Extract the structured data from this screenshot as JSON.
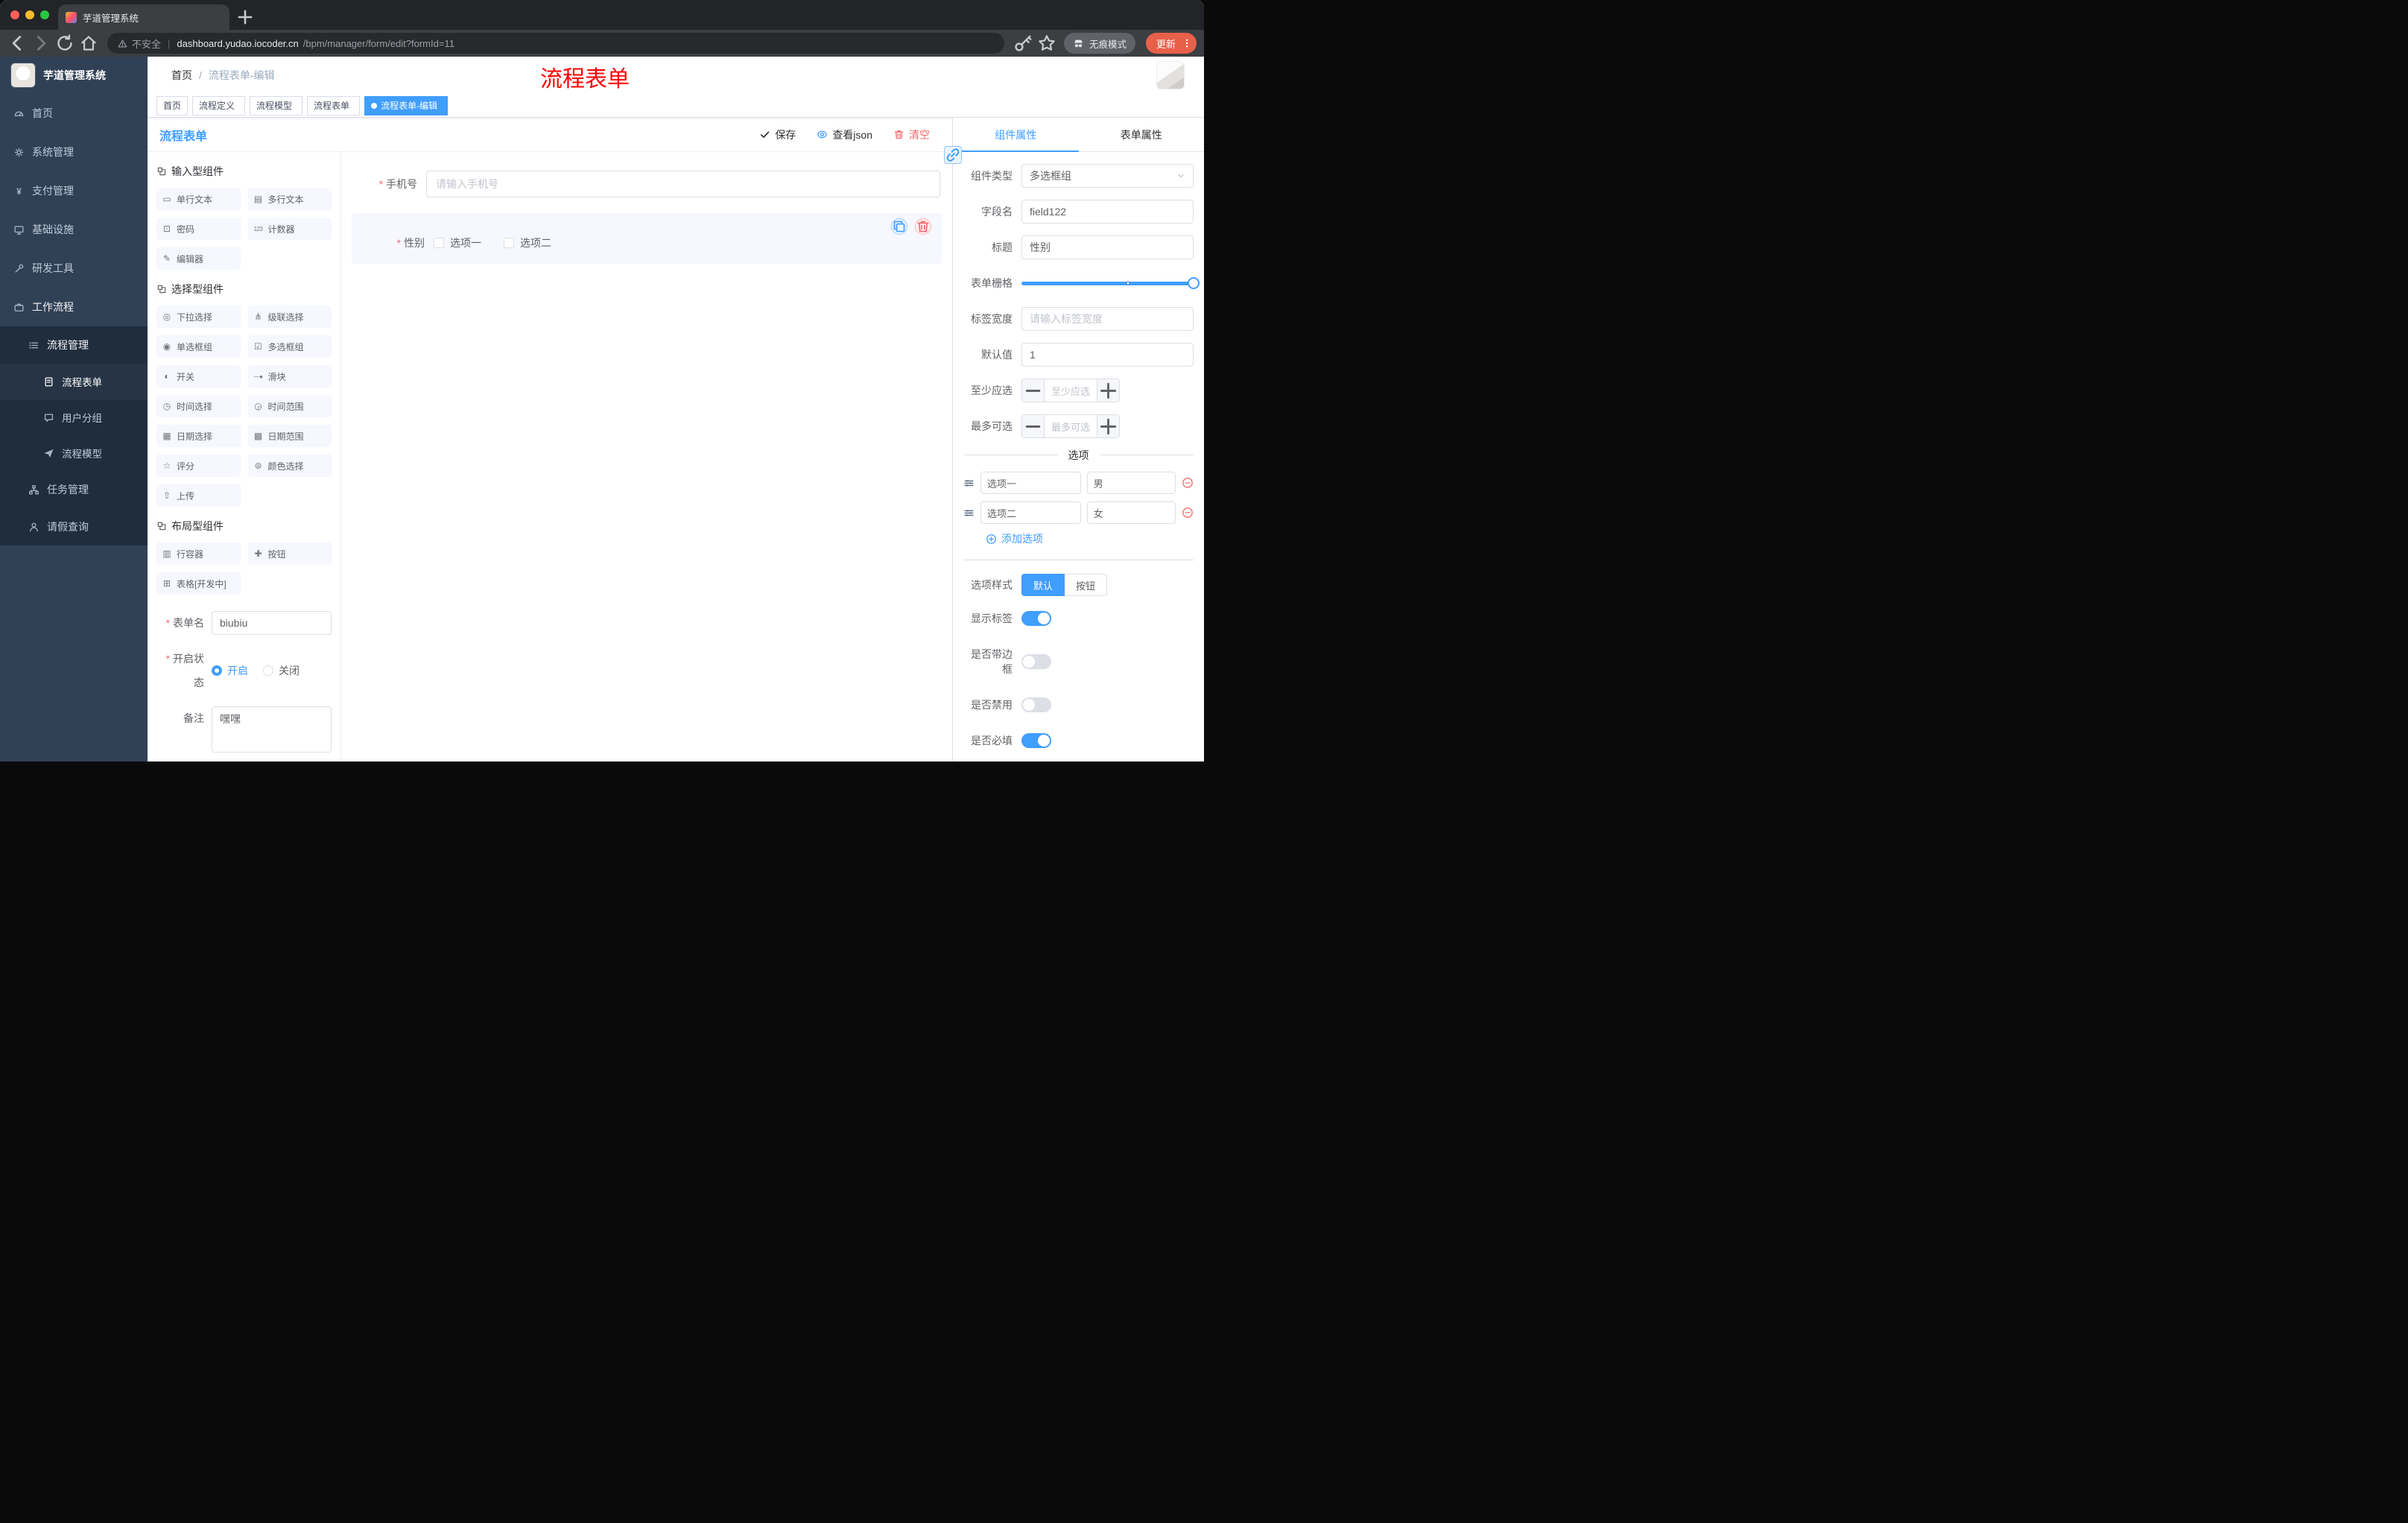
{
  "colors": {
    "accent": "#409eff",
    "danger": "#f56c6c",
    "annotation_red": "#ff0000",
    "sidebar_bg": "#304156",
    "sidebar_sub_bg": "#1f2d3d",
    "tag_active_bg": "#409eff"
  },
  "browser": {
    "tab_title": "芋道管理系统",
    "security_label": "不安全",
    "url_divider": "|",
    "url_domain": "dashboard.yudao.iocoder.cn",
    "url_path": "/bpm/manager/form/edit?formId=11",
    "incognito_label": "无痕模式",
    "update_label": "更新"
  },
  "sidebar": {
    "logo_title": "芋道管理系统",
    "menu": [
      {
        "id": "home",
        "label": "首页",
        "icon": "gauge",
        "level": 1
      },
      {
        "id": "system-manage",
        "label": "系统管理",
        "icon": "gear",
        "level": 1,
        "arrow": "down"
      },
      {
        "id": "payment-manage",
        "label": "支付管理",
        "icon": "yen",
        "level": 1,
        "arrow": "down"
      },
      {
        "id": "infrastructure",
        "label": "基础设施",
        "icon": "infra",
        "level": 1,
        "arrow": "down"
      },
      {
        "id": "dev-tools",
        "label": "研发工具",
        "icon": "tools",
        "level": 1,
        "arrow": "down"
      },
      {
        "id": "workflow",
        "label": "工作流程",
        "icon": "work",
        "level": 1,
        "arrow": "up",
        "open": true
      },
      {
        "id": "process-manage",
        "label": "流程管理",
        "icon": "list",
        "level": 2,
        "arrow": "up",
        "open": true
      },
      {
        "id": "process-form",
        "label": "流程表单",
        "icon": "doc",
        "level": 3,
        "active": true
      },
      {
        "id": "user-group",
        "label": "用户分组",
        "icon": "chat",
        "level": 3
      },
      {
        "id": "process-model",
        "label": "流程模型",
        "icon": "plane",
        "level": 3
      },
      {
        "id": "task-manage",
        "label": "任务管理",
        "icon": "tree",
        "level": 2,
        "arrow": "down"
      },
      {
        "id": "leave-query",
        "label": "请假查询",
        "icon": "person",
        "level": 2
      }
    ]
  },
  "header": {
    "breadcrumb_home": "首页",
    "breadcrumb_sep": "/",
    "breadcrumb_current": "流程表单-编辑",
    "annotation": "流程表单"
  },
  "tags": [
    {
      "id": "home",
      "label": "首页"
    },
    {
      "id": "process-definition",
      "label": "流程定义",
      "closable": true
    },
    {
      "id": "process-model",
      "label": "流程模型",
      "closable": true
    },
    {
      "id": "process-form",
      "label": "流程表单",
      "closable": true
    },
    {
      "id": "process-form-edit",
      "label": "流程表单-编辑",
      "closable": true,
      "active": true
    }
  ],
  "designer": {
    "title": "流程表单",
    "actions": {
      "save": "保存",
      "view_json": "查看json",
      "clear": "清空"
    },
    "palette": [
      {
        "title": "输入型组件",
        "items": [
          {
            "label": "单行文本",
            "icon": "▭"
          },
          {
            "label": "多行文本",
            "icon": "▤"
          },
          {
            "label": "密码",
            "icon": "⊡"
          },
          {
            "label": "计数器",
            "icon": "123"
          },
          {
            "label": "编辑器",
            "icon": "✎"
          }
        ]
      },
      {
        "title": "选择型组件",
        "items": [
          {
            "label": "下拉选择",
            "icon": "◎"
          },
          {
            "label": "级联选择",
            "icon": "⋔"
          },
          {
            "label": "单选框组",
            "icon": "◉"
          },
          {
            "label": "多选框组",
            "icon": "☑"
          },
          {
            "label": "开关",
            "icon": "◐"
          },
          {
            "label": "滑块",
            "icon": "—●"
          },
          {
            "label": "时间选择",
            "icon": "◷"
          },
          {
            "label": "时间范围",
            "icon": "◶"
          },
          {
            "label": "日期选择",
            "icon": "▦"
          },
          {
            "label": "日期范围",
            "icon": "▩"
          },
          {
            "label": "评分",
            "icon": "☆"
          },
          {
            "label": "颜色选择",
            "icon": "⊚"
          },
          {
            "label": "上传",
            "icon": "⇧"
          }
        ]
      },
      {
        "title": "布局型组件",
        "items": [
          {
            "label": "行容器",
            "icon": "▥"
          },
          {
            "label": "按钮",
            "icon": "✚"
          },
          {
            "label": "表格[开发中]",
            "icon": "⊞"
          }
        ]
      }
    ],
    "meta": {
      "form_name_label": "表单名",
      "form_name_value": "biubiu",
      "status_label": "开启状态",
      "status_on": "开启",
      "status_off": "关闭",
      "remark_label": "备注",
      "remark_value": "嘿嘿"
    },
    "canvas": {
      "phone": {
        "label": "手机号",
        "placeholder": "请输入手机号"
      },
      "gender": {
        "label": "性别",
        "options": [
          "选项一",
          "选项二"
        ]
      }
    }
  },
  "props": {
    "tabs": [
      "组件属性",
      "表单属性"
    ],
    "fields": {
      "type_label": "组件类型",
      "type_value": "多选框组",
      "field_label": "字段名",
      "field_value": "field122",
      "title_label": "标题",
      "title_value": "性别",
      "grid_label": "表单栅格",
      "label_width_label": "标签宽度",
      "label_width_placeholder": "请输入标签宽度",
      "default_label": "默认值",
      "default_value": "1",
      "min_label": "至少应选",
      "min_placeholder": "至少应选",
      "max_label": "最多可选",
      "max_placeholder": "最多可选"
    },
    "options": {
      "divider": "选项",
      "rows": [
        {
          "label": "选项一",
          "value": "男"
        },
        {
          "label": "选项二",
          "value": "女"
        }
      ],
      "add_label": "添加选项"
    },
    "style": {
      "label": "选项样式",
      "choices": [
        "默认",
        "按钮"
      ],
      "active": 0
    },
    "switches": [
      {
        "id": "show-label",
        "label": "显示标签",
        "on": true
      },
      {
        "id": "border",
        "label": "是否带边框",
        "on": false
      },
      {
        "id": "disabled",
        "label": "是否禁用",
        "on": false
      },
      {
        "id": "required",
        "label": "是否必填",
        "on": true
      }
    ]
  }
}
